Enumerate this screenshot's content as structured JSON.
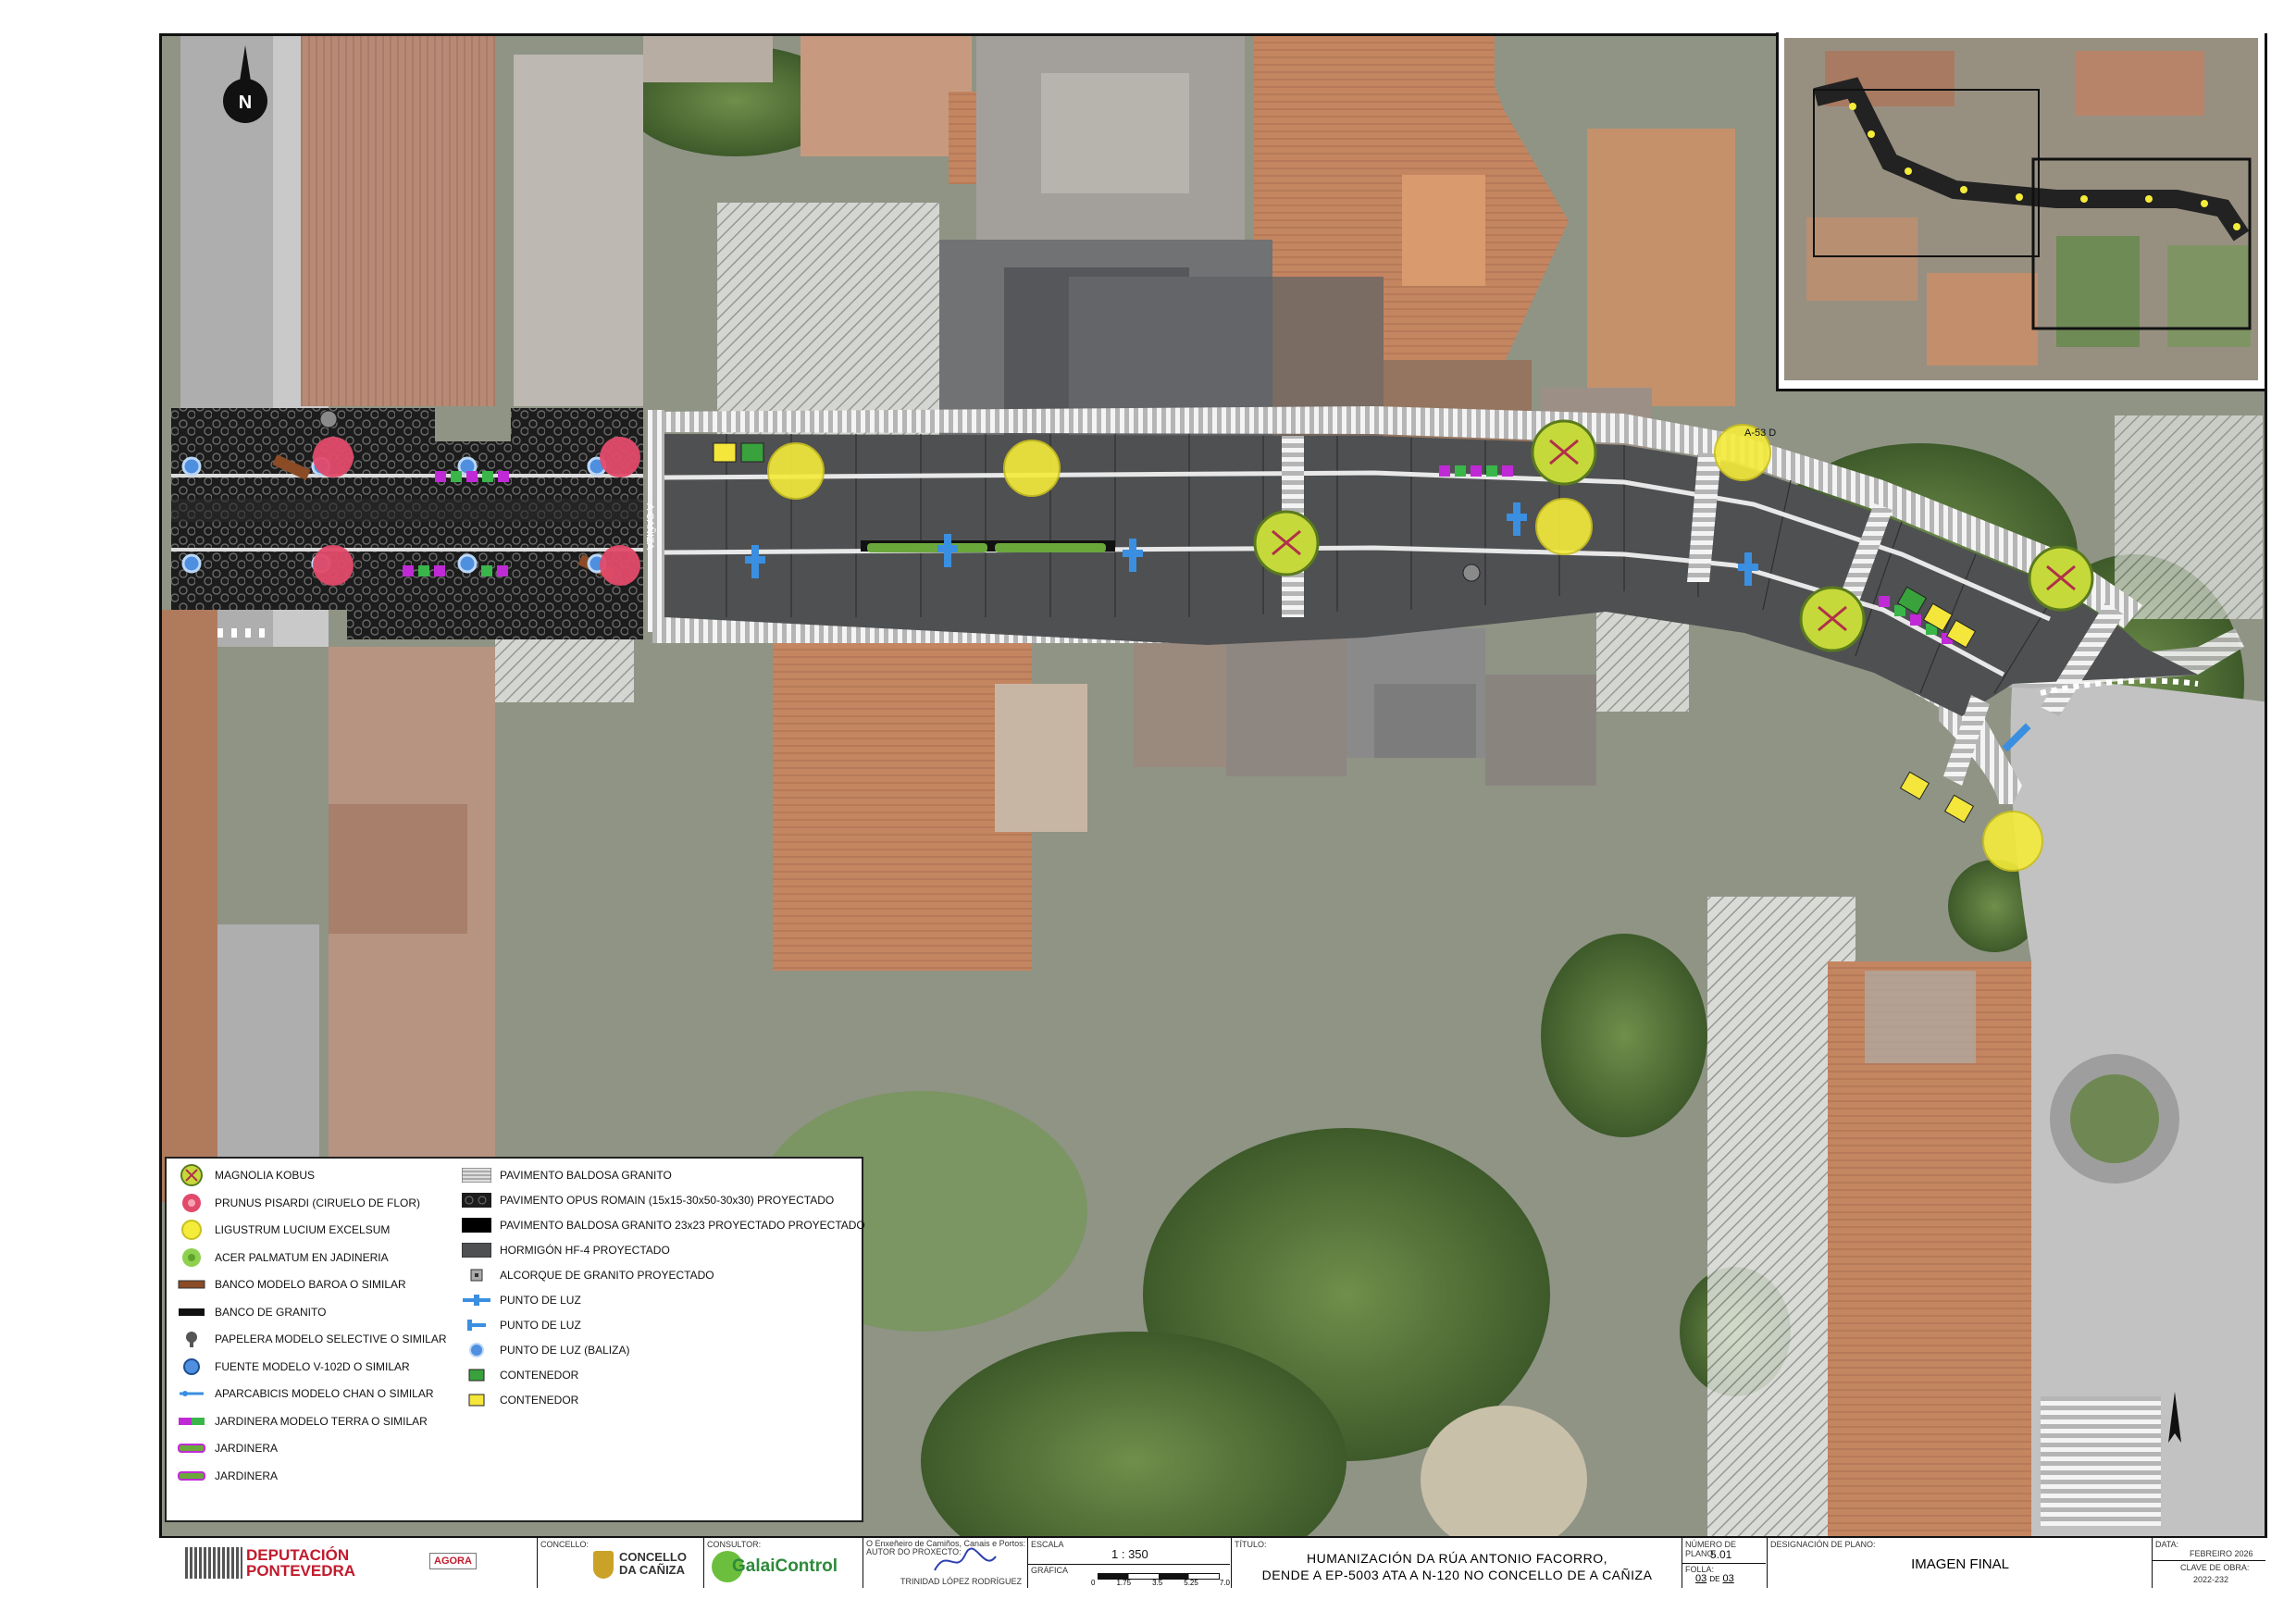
{
  "legend": {
    "left": [
      {
        "label": "MAGNOLIA KOBUS",
        "icon": "magnolia-tree-icon"
      },
      {
        "label": "PRUNUS PISARDI (CIRUELO DE FLOR)",
        "icon": "prunus-tree-icon"
      },
      {
        "label": "LIGUSTRUM LUCIUM EXCELSUM",
        "icon": "ligustrum-tree-icon"
      },
      {
        "label": "ACER PALMATUM EN JADINERIA",
        "icon": "acer-tree-icon"
      },
      {
        "label": "BANCO MODELO BAROA O SIMILAR",
        "icon": "bench-baroa-icon"
      },
      {
        "label": "BANCO DE GRANITO",
        "icon": "granite-bench-icon"
      },
      {
        "label": "PAPELERA MODELO SELECTIVE O SIMILAR",
        "icon": "litter-bin-icon"
      },
      {
        "label": "FUENTE MODELO V-102D O SIMILAR",
        "icon": "fountain-icon"
      },
      {
        "label": "APARCABICIS MODELO CHAN O SIMILAR",
        "icon": "bike-rack-icon"
      },
      {
        "label": "JARDINERA MODELO TERRA O SIMILAR",
        "icon": "planter-terra-icon"
      },
      {
        "label": "JARDINERA",
        "icon": "planter-icon"
      },
      {
        "label": "JARDINERA",
        "icon": "planter-icon"
      }
    ],
    "right": [
      {
        "label": "PAVIMENTO BALDOSA GRANITO",
        "icon": "granite-paving-swatch"
      },
      {
        "label": "PAVIMENTO OPUS ROMAIN (15x15-30x50-30x30) PROYECTADO",
        "icon": "opus-romain-swatch"
      },
      {
        "label": "PAVIMENTO BALDOSA GRANITO 23x23 PROYECTADO PROYECTADO",
        "icon": "granite-23-swatch"
      },
      {
        "label": "HORMIGÓN HF-4 PROYECTADO",
        "icon": "concrete-swatch"
      },
      {
        "label": "ALCORQUE DE GRANITO PROYECTADO",
        "icon": "tree-pit-icon"
      },
      {
        "label": "PUNTO DE LUZ",
        "icon": "street-light-double-icon"
      },
      {
        "label": "PUNTO DE LUZ",
        "icon": "street-light-icon"
      },
      {
        "label": "PUNTO DE LUZ (BALIZA)",
        "icon": "bollard-light-icon"
      },
      {
        "label": "CONTENEDOR",
        "icon": "container-green-icon"
      },
      {
        "label": "CONTENEDOR",
        "icon": "container-yellow-icon"
      }
    ]
  },
  "map_labels": {
    "street_label_vertical": "A CAÑIZA",
    "north_letter": "N",
    "small_label": "A-53 D"
  },
  "title_block": {
    "client": "DEPUTACIÓN\nPONTEVEDRA",
    "agora": "AGORA",
    "concello_caption": "CONCELLO:",
    "concello": "CONCELLO\nDA CAÑIZA",
    "consultor_caption": "CONSULTOR:",
    "consultor": "GalaiControl",
    "author_caption": "O Enxeñeiro de Camiños, Canais e Portos:\nAUTOR DO PROXECTO:",
    "author": "TRINIDAD LÓPEZ RODRÍGUEZ",
    "escala_caption": "ESCALA",
    "escala": "1 : 350",
    "grafica_caption": "GRÁFICA",
    "scale_ticks": [
      "0",
      "1.75",
      "3.5",
      "5.25",
      "7.0"
    ],
    "titulo_caption": "TÍTULO:",
    "titulo_line1": "HUMANIZACIÓN DA RÚA ANTONIO FACORRO,",
    "titulo_line2": "DENDE A EP-5003 ATA A N-120 NO CONCELLO DE A CAÑIZA",
    "numero_caption": "NÚMERO DE PLANO:",
    "numero": "5.01",
    "folla_caption": "FOLLA:",
    "folla": "03",
    "folla_de": "DE",
    "folla_total": "03",
    "designacion_caption": "DESIGNACIÓN DE PLANO:",
    "designacion": "IMAGEN FINAL",
    "data_caption": "DATA:",
    "data": "FEBREIRO 2026",
    "clave_caption": "CLAVE DE OBRA:",
    "clave": "2022-232"
  },
  "colors": {
    "roof_terracotta": "#c98a62",
    "roof_grey": "#8d8f92",
    "vegetation": "#5c7a3e",
    "concrete": "#4d4d4f",
    "cobble": "#1f1f1f",
    "crosswalk": "#e9e9e9",
    "tree_magnolia": "#c6d93a",
    "tree_prunus": "#e24a6a",
    "tree_ligustrum": "#f4ec3a",
    "light_blue": "#3a8fe0"
  }
}
